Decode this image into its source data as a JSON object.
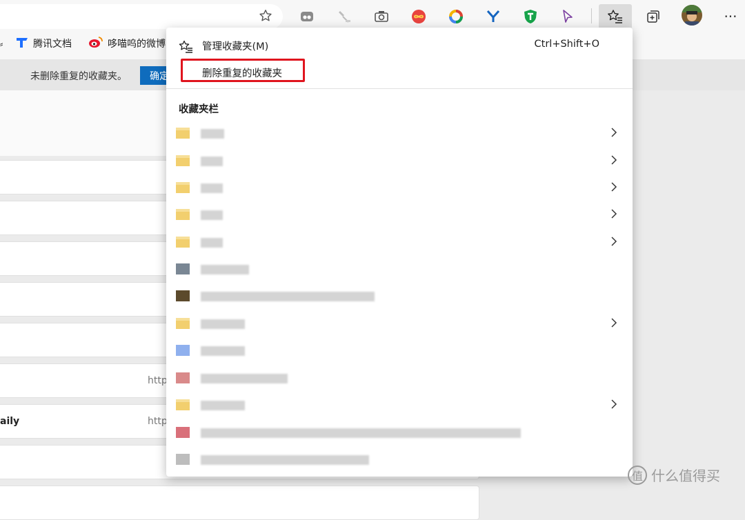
{
  "toolbar": {
    "icons": [
      "favorite-star-icon",
      "reader-icon",
      "eyedropper-icon",
      "camera-icon",
      "infinity-icon",
      "color-ring-icon",
      "y-icon",
      "shield-t-icon",
      "cursor-icon",
      "favorites-icon",
      "collections-icon",
      "avatar",
      "more-icon"
    ],
    "more_label": "···"
  },
  "bookmarks_bar": {
    "items": [
      {
        "label": "腾讯文档",
        "icon": "tencent-docs-icon"
      },
      {
        "label": "哆喵呜的微博",
        "icon": "weibo-icon"
      }
    ]
  },
  "notice": {
    "text": "未删除重复的收藏夹。",
    "button": "确定"
  },
  "background_cards": {
    "title_6": "aily",
    "url_5": "http",
    "url_6": "http"
  },
  "menu": {
    "manage_label": "管理收藏夹(M)",
    "manage_shortcut": "Ctrl+Shift+O",
    "remove_duplicates_label": "删除重复的收藏夹",
    "section_title": "收藏夹栏",
    "items": [
      {
        "type": "folder",
        "has_submenu": true
      },
      {
        "type": "folder",
        "has_submenu": true
      },
      {
        "type": "folder",
        "has_submenu": true
      },
      {
        "type": "folder",
        "has_submenu": true
      },
      {
        "type": "folder",
        "has_submenu": true
      },
      {
        "type": "link",
        "has_submenu": false
      },
      {
        "type": "link",
        "has_submenu": false
      },
      {
        "type": "folder",
        "has_submenu": true
      },
      {
        "type": "link",
        "has_submenu": false
      },
      {
        "type": "link",
        "has_submenu": false
      },
      {
        "type": "folder",
        "has_submenu": true
      },
      {
        "type": "link",
        "has_submenu": false
      },
      {
        "type": "link",
        "has_submenu": false
      }
    ]
  },
  "watermark": {
    "symbol": "值",
    "text": "什么值得买"
  },
  "colors": {
    "accent": "#0f6cbd",
    "highlight_box": "#e0141e",
    "folder": "#f2cf6e"
  }
}
